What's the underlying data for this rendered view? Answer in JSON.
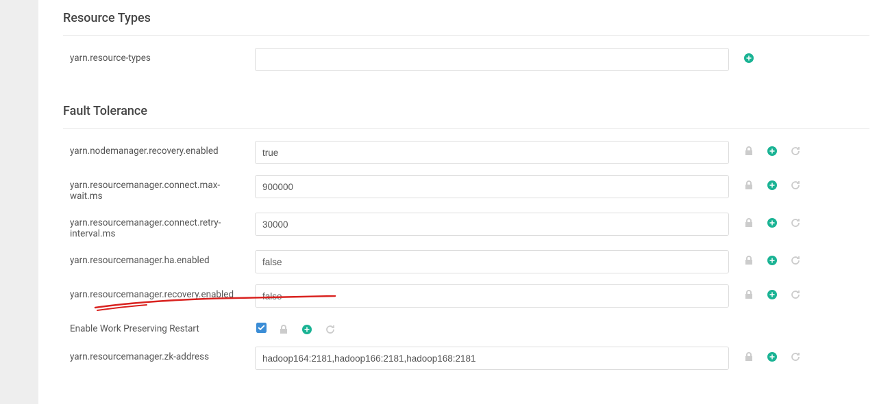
{
  "sections": {
    "resourceTypes": {
      "title": "Resource Types",
      "items": {
        "resource_types": {
          "label": "yarn.resource-types",
          "value": ""
        }
      }
    },
    "faultTolerance": {
      "title": "Fault Tolerance",
      "items": {
        "nm_recovery_enabled": {
          "label": "yarn.nodemanager.recovery.enabled",
          "value": "true"
        },
        "rm_connect_max_wait": {
          "label": "yarn.resourcemanager.connect.max-wait.ms",
          "value": "900000"
        },
        "rm_connect_retry_interval": {
          "label": "yarn.resourcemanager.connect.retry-interval.ms",
          "value": "30000"
        },
        "rm_ha_enabled": {
          "label": "yarn.resourcemanager.ha.enabled",
          "value": "false"
        },
        "rm_recovery_enabled": {
          "label": "yarn.resourcemanager.recovery.enabled",
          "value": "false"
        },
        "work_preserving": {
          "label": "Enable Work Preserving Restart",
          "checked": true
        },
        "rm_zk_address": {
          "label": "yarn.resourcemanager.zk-address",
          "value": "hadoop164:2181,hadoop166:2181,hadoop168:2181"
        }
      }
    }
  },
  "colors": {
    "accent": "#1ab394",
    "muted": "#ccc",
    "label": "#555"
  }
}
